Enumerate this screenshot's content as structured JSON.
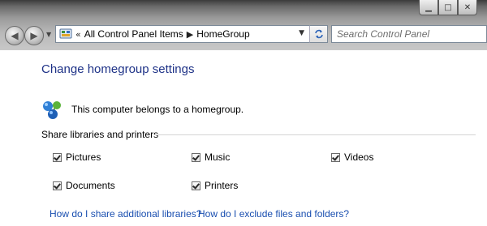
{
  "address_bar": {
    "crumb_root": "All Control Panel Items",
    "crumb_current": "HomeGroup"
  },
  "search": {
    "placeholder": "Search Control Panel"
  },
  "content": {
    "title": "Change homegroup settings",
    "status": "This computer belongs to a homegroup.",
    "section_label": "Share libraries and printers",
    "checkboxes": [
      {
        "label": "Pictures",
        "checked": true
      },
      {
        "label": "Music",
        "checked": true
      },
      {
        "label": "Videos",
        "checked": true
      },
      {
        "label": "Documents",
        "checked": true
      },
      {
        "label": "Printers",
        "checked": true
      }
    ],
    "links": [
      "How do I share additional libraries?",
      "How do I exclude files and folders?"
    ]
  },
  "colors": {
    "title": "#1e3287",
    "link": "#1a4fb0"
  }
}
